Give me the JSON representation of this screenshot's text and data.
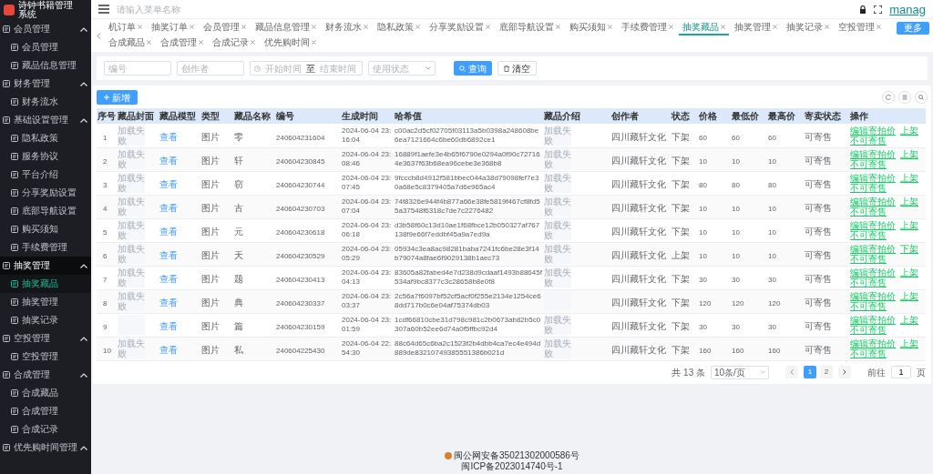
{
  "sidebar": {
    "title": "诗钟书籍管理系统",
    "groups": [
      {
        "label": "会员管理",
        "expanded": true,
        "selected": false,
        "children": [
          {
            "label": "会员管理",
            "selected": false
          },
          {
            "label": "藏品信息管理",
            "selected": false
          }
        ]
      },
      {
        "label": "财务管理",
        "expanded": true,
        "selected": false,
        "children": [
          {
            "label": "财务流水",
            "selected": false
          }
        ]
      },
      {
        "label": "基础设置管理",
        "expanded": true,
        "selected": false,
        "children": [
          {
            "label": "隐私政策",
            "selected": false
          },
          {
            "label": "服务协议",
            "selected": false
          },
          {
            "label": "平台介绍",
            "selected": false
          },
          {
            "label": "分享奖励设置",
            "selected": false
          },
          {
            "label": "底部导航设置",
            "selected": false
          },
          {
            "label": "购买须知",
            "selected": false
          },
          {
            "label": "手续费管理",
            "selected": false
          }
        ]
      },
      {
        "label": "抽奖管理",
        "expanded": true,
        "selected": true,
        "children": [
          {
            "label": "抽奖藏品",
            "selected": true
          },
          {
            "label": "抽奖管理",
            "selected": false
          },
          {
            "label": "抽奖记录",
            "selected": false
          }
        ]
      },
      {
        "label": "空投管理",
        "expanded": true,
        "selected": false,
        "children": [
          {
            "label": "空投管理",
            "selected": false
          }
        ]
      },
      {
        "label": "合成管理",
        "expanded": true,
        "selected": false,
        "children": [
          {
            "label": "合成藏品",
            "selected": false
          },
          {
            "label": "合成管理",
            "selected": false
          },
          {
            "label": "合成记录",
            "selected": false
          }
        ]
      },
      {
        "label": "优先购时间管理",
        "expanded": true,
        "selected": false
      }
    ]
  },
  "header": {
    "search_placeholder": "请输入菜单名称",
    "user": "manag"
  },
  "tabs": [
    {
      "label": "机订单",
      "selected": false
    },
    {
      "label": "抽奖订单",
      "selected": false
    },
    {
      "label": "会员管理",
      "selected": false
    },
    {
      "label": "藏品信息管理",
      "selected": false
    },
    {
      "label": "财务流水",
      "selected": false
    },
    {
      "label": "隐私政策",
      "selected": false
    },
    {
      "label": "分享奖励设置",
      "selected": false
    },
    {
      "label": "底部导航设置",
      "selected": false
    },
    {
      "label": "购买须知",
      "selected": false
    },
    {
      "label": "手续费管理",
      "selected": false
    },
    {
      "label": "抽奖藏品",
      "selected": true
    },
    {
      "label": "抽奖管理",
      "selected": false
    },
    {
      "label": "抽奖记录",
      "selected": false
    },
    {
      "label": "空投管理",
      "selected": false
    },
    {
      "label": "合成藏品",
      "selected": false
    },
    {
      "label": "合成管理",
      "selected": false
    },
    {
      "label": "合成记录",
      "selected": false
    },
    {
      "label": "优先购时间",
      "selected": false
    }
  ],
  "more_button": "更多",
  "filters": {
    "code_placeholder": "编号",
    "creator_placeholder": "创作者",
    "start_placeholder": "开始时间",
    "range_separator": "至",
    "end_placeholder": "结束时间",
    "status_placeholder": "使用状态",
    "search_button": "查询",
    "clear_button": "清空"
  },
  "add_button": "新增",
  "table": {
    "columns": [
      "序号",
      "藏品封面",
      "藏品模型",
      "类型",
      "藏品名称",
      "编号",
      "生成时间",
      "哈希值",
      "藏品介绍",
      "创作者",
      "状态",
      "价格",
      "最低价",
      "最高价",
      "寄卖状态",
      "操作"
    ],
    "rows": [
      {
        "index": "1",
        "cover": "加载失败",
        "model": "查看",
        "type": "图片",
        "name": "零",
        "code": "240604231604",
        "time": "2024-06-04 23:16:04",
        "hash": "c00ac2d5cf02705f03113a5b0398a248608be6ea7121664c6be60db6892ce1",
        "intro": "加载失败",
        "creator": "四川藏轩文化",
        "status": "下架",
        "price": "60",
        "min_price": "60",
        "max_price": "60",
        "consign": "可寄售",
        "actions": [
          "编辑寄拍价",
          "上架",
          "不可寄售"
        ]
      },
      {
        "index": "2",
        "cover": "加载失败",
        "model": "查看",
        "type": "图片",
        "name": "轩",
        "code": "240604230845",
        "time": "2024-06-04 23:08:46",
        "hash": "16889f1aefe3e4b65f6790e0294a0f90c727164e3637f63b68ea96cebe3e368b8",
        "intro": "加载失败",
        "creator": "四川藏轩文化",
        "status": "下架",
        "price": "10",
        "min_price": "10",
        "max_price": "10",
        "consign": "可寄售",
        "actions": [
          "编辑寄拍价",
          "上架",
          "不可寄售"
        ]
      },
      {
        "index": "3",
        "cover": "加载失败",
        "model": "查看",
        "type": "图片",
        "name": "窃",
        "code": "240604230744",
        "time": "2024-06-04 23:07:45",
        "hash": "9fcccb8d4912f581bbec044a38d79098fef7e30a68e5c8379405a7d6e965ac4",
        "intro": "加载失败",
        "creator": "四川藏轩文化",
        "status": "下架",
        "price": "80",
        "min_price": "80",
        "max_price": "80",
        "consign": "可寄售",
        "actions": [
          "编辑寄拍价",
          "上架",
          "不可寄售"
        ]
      },
      {
        "index": "4",
        "cover": "加载失败",
        "model": "查看",
        "type": "图片",
        "name": "古",
        "code": "240604230703",
        "time": "2024-06-04 23:07:04",
        "hash": "74f8326e944f4b877a66e38fe5819f467cf8fd55a37548f6318c7de7c2276482",
        "intro": "加载失败",
        "creator": "四川藏轩文化",
        "status": "下架",
        "price": "10",
        "min_price": "10",
        "max_price": "10",
        "consign": "可寄售",
        "actions": [
          "编辑寄拍价",
          "上架",
          "不可寄售"
        ]
      },
      {
        "index": "5",
        "cover": "加载失败",
        "model": "查看",
        "type": "图片",
        "name": "元",
        "code": "240604230618",
        "time": "2024-06-04 23:06:18",
        "hash": "d3b58f60c13d10ae1f68fbce12b050327af767138f9e66f7eddbf45a9a7ed9a",
        "intro": "加载失败",
        "creator": "四川藏轩文化",
        "status": "下架",
        "price": "10",
        "min_price": "10",
        "max_price": "10",
        "consign": "可寄售",
        "actions": [
          "编辑寄拍价",
          "上架",
          "不可寄售"
        ]
      },
      {
        "index": "6",
        "cover": "加载失败",
        "model": "查看",
        "type": "图片",
        "name": "天",
        "code": "240604230529",
        "time": "2024-06-04 23:05:29",
        "hash": "05934c3ea8ac98281baba7241fc6be28e3f14b79074a8fae6f9029138b1aec73",
        "intro": "加载失败",
        "creator": "四川藏轩文化",
        "status": "上架",
        "price": "10",
        "min_price": "10",
        "max_price": "10",
        "consign": "可寄售",
        "actions": [
          "编辑寄拍价",
          "下架",
          "不可寄售"
        ]
      },
      {
        "index": "7",
        "cover": "加载失败",
        "model": "查看",
        "type": "图片",
        "name": "题",
        "code": "240604230413",
        "time": "2024-06-04 23:04:13",
        "hash": "83605a82fabed4e7d238d9cdaaf1493b88645f534af9bc8377c3c28658b8e0f8",
        "intro": "加载失败",
        "creator": "四川藏轩文化",
        "status": "下架",
        "price": "30",
        "min_price": "30",
        "max_price": "30",
        "consign": "可寄售",
        "actions": [
          "编辑寄拍价",
          "上架",
          "不可寄售"
        ]
      },
      {
        "index": "8",
        "cover": "加载失败",
        "model": "查看",
        "type": "图片",
        "name": "典",
        "code": "240604230337",
        "time": "2024-06-04 23:03:37",
        "hash": "2c56a7f6097bf52cf5acf0f255e2134e1254ce68dd717b0c6e04af75374db03",
        "creator": "四川藏轩文化",
        "status": "下架",
        "price": "120",
        "min_price": "120",
        "max_price": "120",
        "consign": "可寄售",
        "actions": [
          "编辑寄拍价",
          "上架",
          "不可寄售"
        ]
      },
      {
        "index": "9",
        "model": "查看",
        "type": "图片",
        "name": "篇",
        "code": "240604230159",
        "time": "2024-06-04 23:01:59",
        "hash": "1cdf66810cbe31d798c981c2b0673ab82b5c0307a60b52ee6d74a0f5ffbc92d4",
        "intro": "加载失败",
        "creator": "四川藏轩文化",
        "status": "下架",
        "price": "30",
        "min_price": "30",
        "max_price": "30",
        "consign": "可寄售",
        "actions": [
          "编辑寄拍价",
          "上架",
          "不可寄售"
        ]
      },
      {
        "index": "10",
        "cover": "加载失败",
        "model": "查看",
        "type": "图片",
        "name": "私",
        "code": "240604225430",
        "time": "2024-06-04 22:54:30",
        "hash": "88c64d65c6ba2c1523f2b4dbb4ca7ec4e494d889de83210749385551386b021d",
        "intro": "加载失败",
        "creator": "四川藏轩文化",
        "status": "下架",
        "price": "160",
        "min_price": "160",
        "max_price": "160",
        "consign": "可寄售",
        "actions": [
          "编辑寄拍价",
          "上架",
          "不可寄售"
        ]
      }
    ]
  },
  "pagination": {
    "total": "共 13 条",
    "page_size": "10条/页",
    "pages": [
      {
        "label": "1",
        "selected": true
      },
      {
        "label": "2",
        "selected": false
      }
    ],
    "goto_label": "前往",
    "goto_value": "1",
    "goto_suffix": "页"
  },
  "footer": [
    "闽公网安备35021302000586号",
    "闽ICP备2023014740号-1"
  ]
}
